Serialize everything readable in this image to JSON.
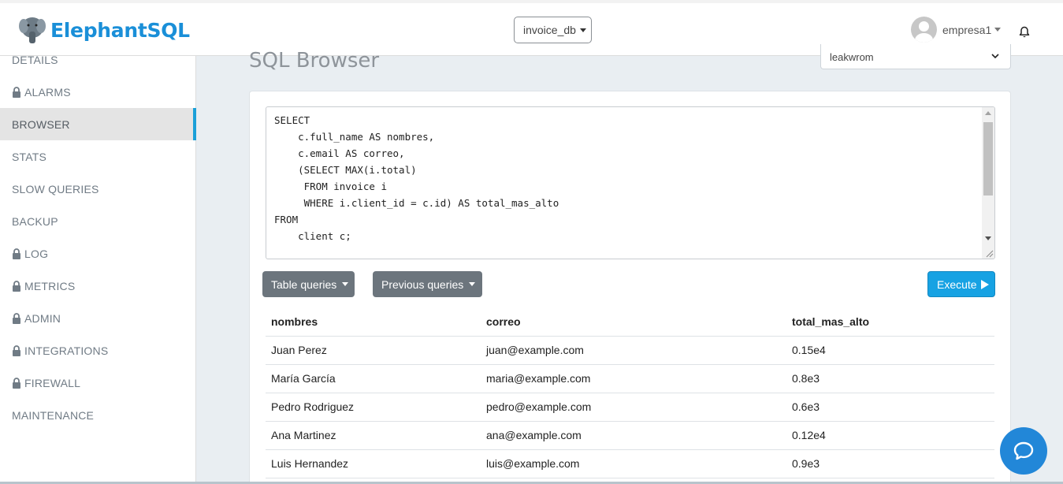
{
  "header": {
    "brand": "ElephantSQL",
    "database_select": "invoice_db",
    "user": "empresa1"
  },
  "sidebar": {
    "items": [
      {
        "label": "DETAILS",
        "locked": false,
        "active": false
      },
      {
        "label": "ALARMS",
        "locked": true,
        "active": false
      },
      {
        "label": "BROWSER",
        "locked": false,
        "active": true
      },
      {
        "label": "STATS",
        "locked": false,
        "active": false
      },
      {
        "label": "SLOW QUERIES",
        "locked": false,
        "active": false
      },
      {
        "label": "BACKUP",
        "locked": false,
        "active": false
      },
      {
        "label": "LOG",
        "locked": true,
        "active": false
      },
      {
        "label": "METRICS",
        "locked": true,
        "active": false
      },
      {
        "label": "ADMIN",
        "locked": true,
        "active": false
      },
      {
        "label": "INTEGRATIONS",
        "locked": true,
        "active": false
      },
      {
        "label": "FIREWALL",
        "locked": true,
        "active": false
      },
      {
        "label": "MAINTENANCE",
        "locked": false,
        "active": false
      }
    ]
  },
  "main": {
    "title": "SQL Browser",
    "table_select": "leakwrom",
    "query": "SELECT\n    c.full_name AS nombres,\n    c.email AS correo,\n    (SELECT MAX(i.total)\n     FROM invoice i\n     WHERE i.client_id = c.id) AS total_mas_alto\nFROM\n    client c;",
    "buttons": {
      "table_queries": "Table queries",
      "previous_queries": "Previous queries",
      "execute": "Execute"
    },
    "results": {
      "columns": [
        "nombres",
        "correo",
        "total_mas_alto"
      ],
      "rows": [
        [
          "Juan Perez",
          "juan@example.com",
          "0.15e4"
        ],
        [
          "María García",
          "maria@example.com",
          "0.8e3"
        ],
        [
          "Pedro Rodriguez",
          "pedro@example.com",
          "0.6e3"
        ],
        [
          "Ana Martinez",
          "ana@example.com",
          "0.12e4"
        ],
        [
          "Luis Hernandez",
          "luis@example.com",
          "0.9e3"
        ]
      ]
    }
  },
  "colors": {
    "brand": "#1a8fd8",
    "execute": "#17a2e3",
    "active_indicator": "#1ba0d8",
    "chat": "#2287d8"
  },
  "icons": [
    "elephant-logo-icon",
    "bell-icon",
    "lock-icon",
    "play-icon",
    "chat-icon",
    "chevron-down-icon"
  ]
}
